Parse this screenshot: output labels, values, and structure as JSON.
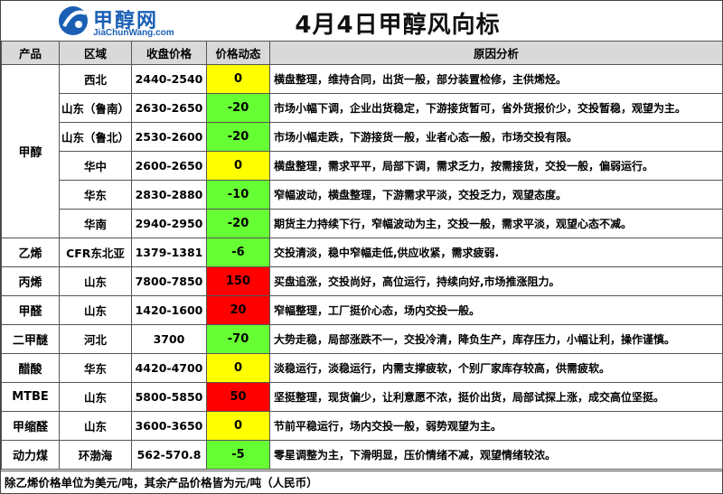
{
  "header": {
    "logo_cn": "甲醇网",
    "logo_en": "JiaChunWang.com",
    "title": "4月4日甲醇风向标"
  },
  "columns": [
    "产品",
    "区域",
    "收盘价格",
    "价格动态",
    "原因分析"
  ],
  "rows": [
    {
      "product": "甲醇",
      "region": "西北",
      "price": "2440-2540",
      "change": "0",
      "color": "yellow",
      "reason": "横盘整理，维持合同，出货一般，部分装置检修，主供烯烃。"
    },
    {
      "product": "",
      "region": "山东（鲁南）",
      "price": "2630-2650",
      "change": "-20",
      "color": "green",
      "reason": "市场小幅下调，企业出货稳定，下游接货暂可，省外货报价少，交投暂稳，观望为主。"
    },
    {
      "product": "",
      "region": "山东（鲁北）",
      "price": "2530-2600",
      "change": "-20",
      "color": "green",
      "reason": "市场小幅走跌，下游接货一般，业者心态一般，市场交投有限。"
    },
    {
      "product": "",
      "region": "华中",
      "price": "2600-2650",
      "change": "0",
      "color": "yellow",
      "reason": "横盘整理，需求平平，局部下调，需求乏力，按需接货，交投一般，偏弱运行。"
    },
    {
      "product": "",
      "region": "华东",
      "price": "2830-2880",
      "change": "-10",
      "color": "green",
      "reason": "窄幅波动，横盘整理，下游需求平淡，交投乏力，观望态度。"
    },
    {
      "product": "",
      "region": "华南",
      "price": "2940-2950",
      "change": "-20",
      "color": "green",
      "reason": "期货主力持续下行，窄幅波动为主，交投一般，需求平淡，观望心态不减。"
    },
    {
      "product": "乙烯",
      "region": "CFR东北亚",
      "price": "1379-1381",
      "change": "-6",
      "color": "green",
      "reason": "交投清淡，稳中窄幅走低,供应收紧，需求疲弱."
    },
    {
      "product": "丙烯",
      "region": "山东",
      "price": "7800-7850",
      "change": "150",
      "color": "red",
      "reason": "买盘追涨，交投尚好，高位运行，持续向好,市场推涨阻力。"
    },
    {
      "product": "甲醛",
      "region": "山东",
      "price": "1420-1600",
      "change": "20",
      "color": "red",
      "reason": "窄幅整理，工厂挺价心态，场内交投一般。"
    },
    {
      "product": "二甲醚",
      "region": "河北",
      "price": "3700",
      "change": "-70",
      "color": "green",
      "reason": "大势走稳，局部涨跌不一，交投冷清，降负生产，库存压力，小幅让利，操作谨慎。"
    },
    {
      "product": "醋酸",
      "region": "华东",
      "price": "4420-4700",
      "change": "0",
      "color": "yellow",
      "reason": "淡稳运行，淡稳运行，内需支撑疲软，个别厂家库存较高，供需疲软。"
    },
    {
      "product": "MTBE",
      "region": "山东",
      "price": "5800-5850",
      "change": "50",
      "color": "red",
      "reason": "坚挺整理，现货偏少，让利意愿不浓，挺价出货，局部试探上涨，成交高位坚挺。"
    },
    {
      "product": "甲缩醛",
      "region": "山东",
      "price": "3600-3650",
      "change": "0",
      "color": "yellow",
      "reason": "节前平稳运行，场内交投一般，弱势观望为主。"
    },
    {
      "product": "动力煤",
      "region": "环渤海",
      "price": "562-570.8",
      "change": "-5",
      "color": "green",
      "reason": "零星调整为主，下滑明显，压价情绪不减，观望情绪较浓。"
    }
  ],
  "footer": "除乙烯价格单位为美元/吨，其余产品价格皆为元/吨（人民币）",
  "colors": {
    "yellow": "#ffff00",
    "green": "#66ff33",
    "red": "#ff0000",
    "header_bg": "#d9d9d9",
    "brand": "#1a5fb4"
  }
}
